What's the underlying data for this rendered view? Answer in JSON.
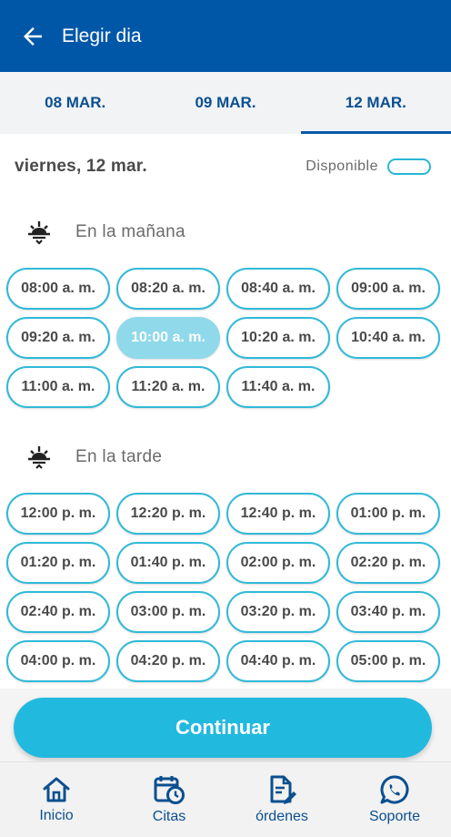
{
  "header": {
    "title": "Elegir dia"
  },
  "tabs": [
    {
      "label": "08 MAR."
    },
    {
      "label": "09 MAR."
    },
    {
      "label": "12 MAR."
    }
  ],
  "day": {
    "label": "viernes, 12 mar.",
    "legend": "Disponible"
  },
  "morning": {
    "title": "En la mañana",
    "slots": [
      "08:00 a. m.",
      "08:20 a. m.",
      "08:40 a. m.",
      "09:00 a. m.",
      "09:20 a. m.",
      "10:00 a. m.",
      "10:20 a. m.",
      "10:40 a. m.",
      "11:00 a. m.",
      "11:20 a. m.",
      "11:40 a. m."
    ]
  },
  "afternoon": {
    "title": "En la tarde",
    "slots": [
      "12:00 p. m.",
      "12:20 p. m.",
      "12:40 p. m.",
      "01:00 p. m.",
      "01:20 p. m.",
      "01:40 p. m.",
      "02:00 p. m.",
      "02:20 p. m.",
      "02:40 p. m.",
      "03:00 p. m.",
      "03:20 p. m.",
      "03:40 p. m.",
      "04:00 p. m.",
      "04:20 p. m.",
      "04:40 p. m.",
      "05:00 p. m."
    ]
  },
  "continue_label": "Continuar",
  "nav": [
    {
      "label": "Inicio",
      "icon": "home-icon"
    },
    {
      "label": "Citas",
      "icon": "calendar-clock-icon"
    },
    {
      "label": "órdenes",
      "icon": "document-edit-icon"
    },
    {
      "label": "Soporte",
      "icon": "whatsapp-icon"
    }
  ],
  "colors": {
    "header": "#0057a8",
    "accent": "#22b9df",
    "slot_border": "#31b9d8",
    "slot_selected": "#8fd9ea",
    "nav_text": "#0b4f8f"
  }
}
